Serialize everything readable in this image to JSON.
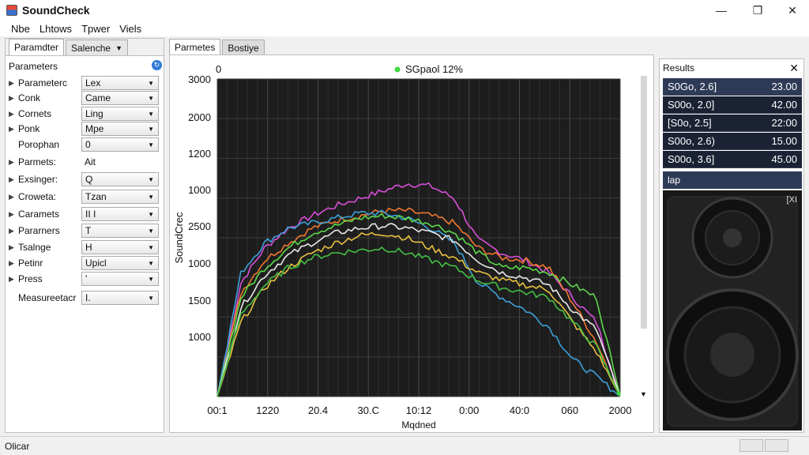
{
  "window": {
    "title": "SoundCheck"
  },
  "menu": [
    "Nbe",
    "Lhtows",
    "Tpwer",
    "Viels"
  ],
  "left_panel": {
    "tabs": [
      {
        "label": "Paramdter"
      },
      {
        "label": "Salenche"
      }
    ],
    "header": "Parameters",
    "rows": [
      {
        "label": "Parameterc",
        "value": "Lex",
        "arrow": true,
        "type": "dropdown"
      },
      {
        "label": "Conk",
        "value": "Came",
        "arrow": true,
        "type": "dropdown"
      },
      {
        "label": "Cornets",
        "value": "Ling",
        "arrow": true,
        "type": "dropdown"
      },
      {
        "label": "Ponk",
        "value": "Mpe",
        "arrow": true,
        "type": "dropdown"
      },
      {
        "label": "Porophan",
        "value": "0",
        "arrow": false,
        "type": "dropdown"
      },
      {
        "label": "Parmets:",
        "value": "Ait",
        "arrow": true,
        "type": "static"
      },
      {
        "label": "Exsinger:",
        "value": "Q",
        "arrow": true,
        "type": "dropdown"
      },
      {
        "label": "Croweta:",
        "value": "Tzan",
        "arrow": true,
        "type": "dropdown"
      },
      {
        "label": "Caramets",
        "value": "II     I",
        "arrow": true,
        "type": "dropdown"
      },
      {
        "label": "Pararners",
        "value": "T",
        "arrow": true,
        "type": "dropdown"
      },
      {
        "label": "Tsalnge",
        "value": "H",
        "arrow": true,
        "type": "dropdown"
      },
      {
        "label": "Petinr",
        "value": "Upicl",
        "arrow": true,
        "type": "dropdown"
      },
      {
        "label": "Press",
        "value": "'",
        "arrow": true,
        "type": "dropdown"
      },
      {
        "label": "Measureetacr",
        "value": "I.",
        "arrow": false,
        "type": "dropdown"
      }
    ]
  },
  "center_tabs": [
    {
      "label": "Parmetes"
    },
    {
      "label": "Bostiye"
    }
  ],
  "chart_data": {
    "type": "line",
    "title": "SGpaol 12%",
    "xlabel": "Mqdned",
    "ylabel": "SoundCrec",
    "x_ticks": [
      "00:1",
      "1220",
      "20.4",
      "30.C",
      "10:12",
      "0:00",
      "40:0",
      "060",
      "2000"
    ],
    "y_ticks": [
      "3000",
      "2000",
      "1200",
      "1000",
      "2500",
      "1000",
      "1500",
      "1000"
    ],
    "x_top_label": "0",
    "grid": true,
    "series": [
      {
        "color": "#d94fd9",
        "values": [
          0.0,
          0.46,
          0.6,
          0.68,
          0.73,
          0.77,
          0.8,
          0.83,
          0.86,
          0.85,
          0.8,
          0.63,
          0.58,
          0.55,
          0.5,
          0.4,
          0.3,
          0.0
        ]
      },
      {
        "color": "#f07830",
        "values": [
          0.0,
          0.42,
          0.55,
          0.62,
          0.68,
          0.71,
          0.73,
          0.75,
          0.75,
          0.73,
          0.7,
          0.6,
          0.56,
          0.55,
          0.52,
          0.38,
          0.22,
          0.0
        ]
      },
      {
        "color": "#3ca0d8",
        "values": [
          0.0,
          0.5,
          0.62,
          0.68,
          0.7,
          0.72,
          0.74,
          0.74,
          0.72,
          0.68,
          0.62,
          0.46,
          0.4,
          0.35,
          0.28,
          0.15,
          0.08,
          0.0
        ]
      },
      {
        "color": "#5cd84a",
        "values": [
          0.0,
          0.4,
          0.52,
          0.6,
          0.66,
          0.69,
          0.72,
          0.73,
          0.72,
          0.7,
          0.66,
          0.58,
          0.52,
          0.52,
          0.5,
          0.45,
          0.4,
          0.0
        ]
      },
      {
        "color": "#e8e8e8",
        "values": [
          0.0,
          0.36,
          0.49,
          0.57,
          0.62,
          0.66,
          0.68,
          0.69,
          0.68,
          0.66,
          0.63,
          0.55,
          0.5,
          0.48,
          0.45,
          0.35,
          0.27,
          0.0
        ]
      },
      {
        "color": "#e8c040",
        "values": [
          0.0,
          0.3,
          0.44,
          0.52,
          0.58,
          0.62,
          0.65,
          0.66,
          0.64,
          0.6,
          0.56,
          0.5,
          0.47,
          0.45,
          0.43,
          0.3,
          0.18,
          0.0
        ]
      },
      {
        "color": "#44c044",
        "values": [
          0.0,
          0.33,
          0.45,
          0.52,
          0.56,
          0.58,
          0.59,
          0.6,
          0.58,
          0.55,
          0.52,
          0.47,
          0.44,
          0.42,
          0.4,
          0.3,
          0.2,
          0.0
        ]
      }
    ]
  },
  "results": {
    "title": "Results",
    "rows": [
      {
        "label": "S0Go, 2.6]",
        "value": "23.00"
      },
      {
        "label": "S00o, 2.0]",
        "value": "42.00"
      },
      {
        "label": "[S0o, 2.5]",
        "value": "22:00"
      },
      {
        "label": "S00o, 2.6)",
        "value": "15.00"
      },
      {
        "label": "S00o, 3.6]",
        "value": "45.00"
      }
    ],
    "extra": "lap",
    "speaker_tag": "[XI"
  },
  "status": {
    "text": "Olicar"
  }
}
